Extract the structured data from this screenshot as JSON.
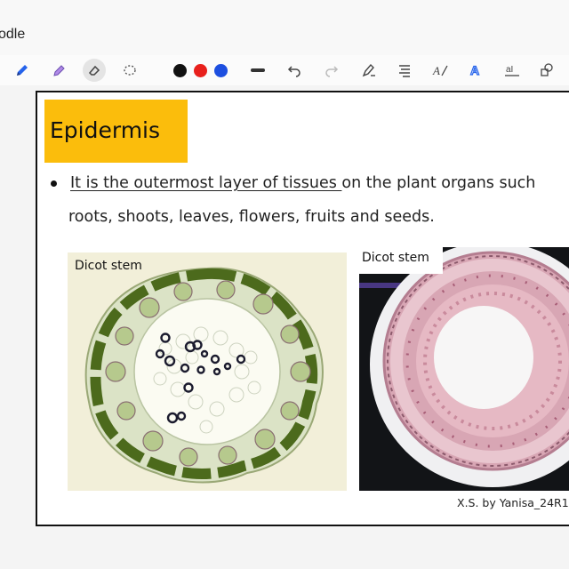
{
  "app": {
    "title": "odle"
  },
  "toolbar": {
    "tools": [
      "pen-icon",
      "highlighter-icon",
      "eraser-icon",
      "lasso-icon"
    ],
    "colors": [
      "#111111",
      "#e8201c",
      "#1d4fe0"
    ],
    "actions": [
      "stroke-width-icon",
      "undo-icon",
      "redo-icon",
      "shape-pen-icon",
      "text-align-icon",
      "text-tool-icon",
      "text-style-icon",
      "text-box-icon",
      "shapes-icon"
    ]
  },
  "slide": {
    "heading": "Epidermis",
    "bullet": {
      "underlined": "It is the outermost layer of tissues ",
      "rest": "on the plant organs such",
      "line2": "roots, shoots, leaves, flowers, fruits and seeds."
    },
    "images": [
      {
        "label": "Dicot stem"
      },
      {
        "label": "Dicot stem"
      }
    ],
    "credit": "X.S. by Yanisa_24R1"
  }
}
